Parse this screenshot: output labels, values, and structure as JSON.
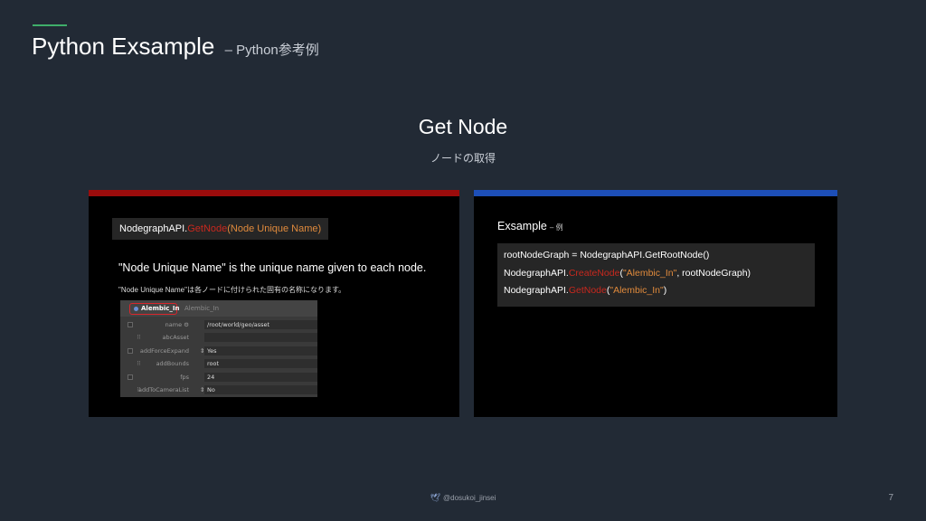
{
  "slide": {
    "title": "Python Exsample",
    "title_sub": "– Python参考例",
    "accent_color": "#3fae6a"
  },
  "section": {
    "title": "Get Node",
    "subtitle": "ノードの取得"
  },
  "left_panel": {
    "accent_color": "#9b0c0c",
    "signature": {
      "prefix": "NodegraphAPI.",
      "method": "GetNode",
      "args": "(Node Unique Name)"
    },
    "description_en": "\"Node Unique Name\" is the unique name given to each node.",
    "description_jp": "\"Node Unique Name\"は各ノードに付けられた固有の名称になります。",
    "param_editor": {
      "node_name": "Alembic_In",
      "node_type": "Alembic_In",
      "rows": [
        {
          "label": "name",
          "value": "/root/world/geo/asset",
          "icon": "gear-icon"
        },
        {
          "label": "abcAsset",
          "value": ""
        },
        {
          "label": "addForceExpand",
          "value": "Yes",
          "mark": "⇕"
        },
        {
          "label": "addBounds",
          "value": "root"
        },
        {
          "label": "fps",
          "value": "24"
        },
        {
          "label": "addToCameraList",
          "value": "No",
          "mark": "⇕"
        }
      ]
    }
  },
  "right_panel": {
    "accent_color": "#1d4fb8",
    "title": "Exsample",
    "title_sub": "– 例",
    "code": {
      "line1": "rootNodeGraph = NodegraphAPI.GetRootNode()",
      "line2_prefix": "NodegraphAPI.",
      "line2_method": "CreateNode",
      "line2_paren_open": "(",
      "line2_string": "\"Alembic_In\"",
      "line2_rest": ", rootNodeGraph)",
      "line3_prefix": "NodegraphAPI.",
      "line3_method": "GetNode",
      "line3_paren_open": "(",
      "line3_string": "\"Alembic_In\"",
      "line3_rest": ")"
    }
  },
  "footer": {
    "handle": "@dosukoi_jinsei",
    "page_number": "7"
  }
}
